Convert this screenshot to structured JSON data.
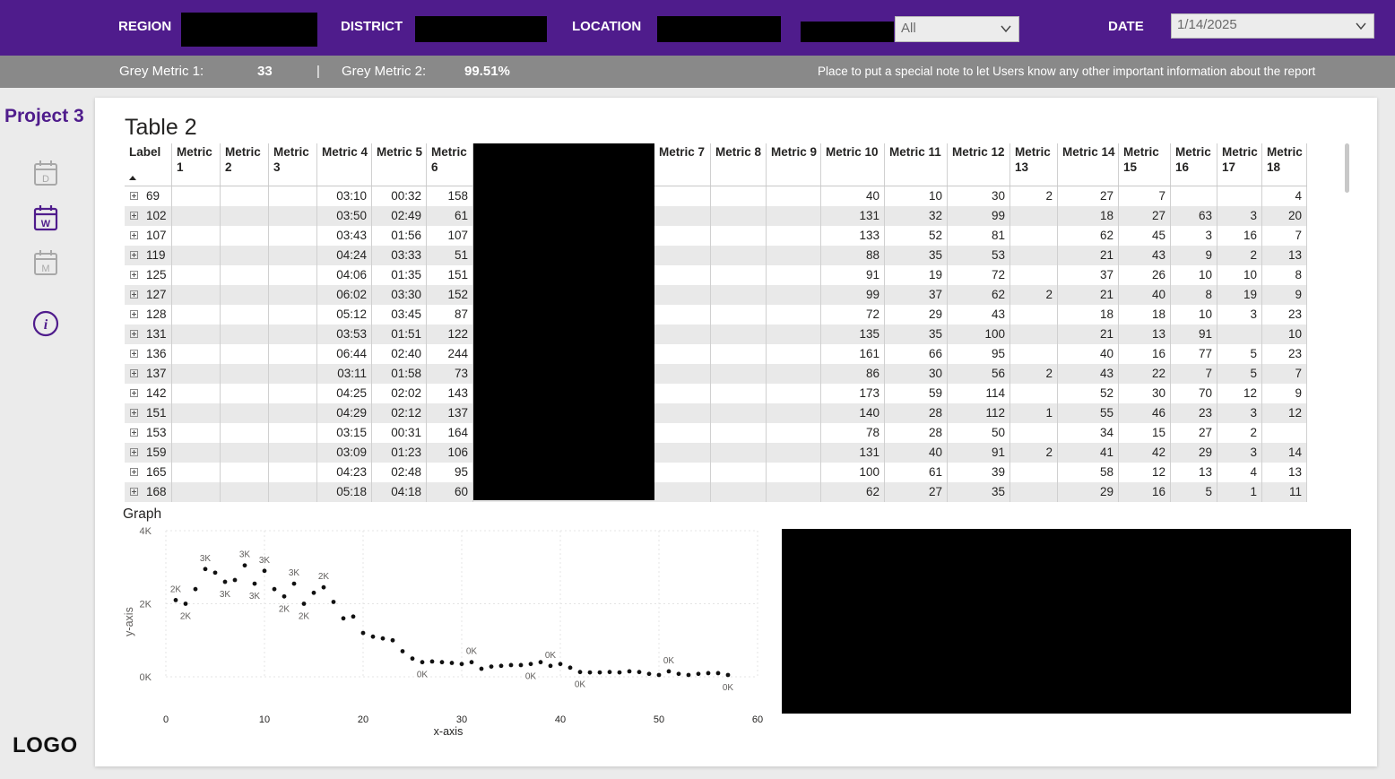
{
  "filters": {
    "region_label": "REGION",
    "district_label": "DISTRICT",
    "location_label": "LOCATION",
    "extra_dropdown_value": "All",
    "date_label": "DATE",
    "date_value": "1/14/2025"
  },
  "metrics_bar": {
    "m1_label": "Grey Metric 1:",
    "m1_value": "33",
    "separator": "|",
    "m2_label": "Grey Metric 2:",
    "m2_value": "99.51%",
    "note": "Place to put a special note to let Users know any other important information about the report"
  },
  "sidebar": {
    "project": "Project 3",
    "icons": [
      "calendar-day-icon",
      "calendar-week-icon",
      "calendar-month-icon",
      "info-icon"
    ],
    "day_letter": "D",
    "week_letter": "W",
    "month_letter": "M",
    "info_letter": "i",
    "logo": "LOGO"
  },
  "colors": {
    "brand_purple": "#4f1c8c",
    "grey_bar": "#898989",
    "row_alt": "#e9e9e9"
  },
  "table": {
    "title": "Table 2",
    "headers": [
      "Label",
      "Metric 1",
      "Metric 2",
      "Metric 3",
      "Metric 4",
      "Metric 5",
      "Metric 6",
      "",
      "Metric 7",
      "Metric 8",
      "Metric 9",
      "Metric 10",
      "Metric 11",
      "Metric 12",
      "Metric 13",
      "Metric 14",
      "Metric 15",
      "Metric 16",
      "Metric 17",
      "Metric 18"
    ],
    "rows": [
      [
        "69",
        "",
        "",
        "",
        "03:10",
        "00:32",
        "158",
        "",
        "",
        "",
        "",
        "40",
        "10",
        "30",
        "2",
        "27",
        "7",
        "",
        "",
        "4"
      ],
      [
        "102",
        "",
        "",
        "",
        "03:50",
        "02:49",
        "61",
        "",
        "",
        "",
        "",
        "131",
        "32",
        "99",
        "",
        "18",
        "27",
        "63",
        "3",
        "20"
      ],
      [
        "107",
        "",
        "",
        "",
        "03:43",
        "01:56",
        "107",
        "",
        "",
        "",
        "",
        "133",
        "52",
        "81",
        "",
        "62",
        "45",
        "3",
        "16",
        "7"
      ],
      [
        "119",
        "",
        "",
        "",
        "04:24",
        "03:33",
        "51",
        "",
        "",
        "",
        "",
        "88",
        "35",
        "53",
        "",
        "21",
        "43",
        "9",
        "2",
        "13"
      ],
      [
        "125",
        "",
        "",
        "",
        "04:06",
        "01:35",
        "151",
        "",
        "",
        "",
        "",
        "91",
        "19",
        "72",
        "",
        "37",
        "26",
        "10",
        "10",
        "8"
      ],
      [
        "127",
        "",
        "",
        "",
        "06:02",
        "03:30",
        "152",
        "",
        "",
        "",
        "",
        "99",
        "37",
        "62",
        "2",
        "21",
        "40",
        "8",
        "19",
        "9"
      ],
      [
        "128",
        "",
        "",
        "",
        "05:12",
        "03:45",
        "87",
        "",
        "",
        "",
        "",
        "72",
        "29",
        "43",
        "",
        "18",
        "18",
        "10",
        "3",
        "23"
      ],
      [
        "131",
        "",
        "",
        "",
        "03:53",
        "01:51",
        "122",
        "",
        "",
        "",
        "",
        "135",
        "35",
        "100",
        "",
        "21",
        "13",
        "91",
        "",
        "10"
      ],
      [
        "136",
        "",
        "",
        "",
        "06:44",
        "02:40",
        "244",
        "",
        "",
        "",
        "",
        "161",
        "66",
        "95",
        "",
        "40",
        "16",
        "77",
        "5",
        "23"
      ],
      [
        "137",
        "",
        "",
        "",
        "03:11",
        "01:58",
        "73",
        "",
        "",
        "",
        "",
        "86",
        "30",
        "56",
        "2",
        "43",
        "22",
        "7",
        "5",
        "7"
      ],
      [
        "142",
        "",
        "",
        "",
        "04:25",
        "02:02",
        "143",
        "",
        "",
        "",
        "",
        "173",
        "59",
        "114",
        "",
        "52",
        "30",
        "70",
        "12",
        "9"
      ],
      [
        "151",
        "",
        "",
        "",
        "04:29",
        "02:12",
        "137",
        "",
        "",
        "",
        "",
        "140",
        "28",
        "112",
        "1",
        "55",
        "46",
        "23",
        "3",
        "12"
      ],
      [
        "153",
        "",
        "",
        "",
        "03:15",
        "00:31",
        "164",
        "",
        "",
        "",
        "",
        "78",
        "28",
        "50",
        "",
        "34",
        "15",
        "27",
        "2",
        ""
      ],
      [
        "159",
        "",
        "",
        "",
        "03:09",
        "01:23",
        "106",
        "",
        "",
        "",
        "",
        "131",
        "40",
        "91",
        "2",
        "41",
        "42",
        "29",
        "3",
        "14"
      ],
      [
        "165",
        "",
        "",
        "",
        "04:23",
        "02:48",
        "95",
        "",
        "",
        "",
        "",
        "100",
        "61",
        "39",
        "",
        "58",
        "12",
        "13",
        "4",
        "13"
      ],
      [
        "168",
        "",
        "",
        "",
        "05:18",
        "04:18",
        "60",
        "",
        "",
        "",
        "",
        "62",
        "27",
        "35",
        "",
        "29",
        "16",
        "5",
        "1",
        "11"
      ]
    ]
  },
  "chart_data": {
    "type": "scatter",
    "title": "Graph",
    "xlabel": "x-axis",
    "ylabel": "y-axis",
    "xlim": [
      0,
      60
    ],
    "ylim": [
      0,
      4000
    ],
    "x_ticks": [
      "0",
      "10",
      "20",
      "30",
      "40",
      "50",
      "60"
    ],
    "y_ticks": [
      "0K",
      "2K",
      "4K"
    ],
    "grid": true,
    "series": [
      {
        "x": [
          1,
          2,
          3,
          4,
          5,
          6,
          7,
          8,
          9,
          10,
          11,
          12,
          13,
          14,
          15,
          16,
          17,
          18,
          19,
          20,
          21,
          22,
          23,
          24,
          25,
          26,
          27,
          28,
          29,
          30,
          31,
          32,
          33,
          34,
          35,
          36,
          37,
          38,
          39,
          40,
          41,
          42,
          43,
          44,
          45,
          46,
          47,
          48,
          49,
          50,
          51,
          52,
          53,
          54,
          55,
          56,
          57
        ],
        "y": [
          2100,
          2000,
          2400,
          2950,
          2850,
          2600,
          2650,
          3050,
          2550,
          2900,
          2400,
          2200,
          2550,
          2000,
          2300,
          2450,
          2050,
          1600,
          1650,
          1200,
          1100,
          1050,
          1000,
          700,
          500,
          400,
          420,
          400,
          380,
          350,
          400,
          220,
          280,
          300,
          320,
          320,
          350,
          400,
          300,
          350,
          250,
          130,
          120,
          120,
          130,
          120,
          150,
          130,
          80,
          50,
          150,
          80,
          50,
          80,
          100,
          100,
          50
        ]
      }
    ],
    "point_labels": [
      {
        "x": 1,
        "text": "2K"
      },
      {
        "x": 2,
        "text": "2K"
      },
      {
        "x": 4,
        "text": "3K"
      },
      {
        "x": 6,
        "text": "3K"
      },
      {
        "x": 8,
        "text": "3K"
      },
      {
        "x": 9,
        "text": "3K"
      },
      {
        "x": 10,
        "text": "3K"
      },
      {
        "x": 12,
        "text": "2K"
      },
      {
        "x": 13,
        "text": "3K"
      },
      {
        "x": 14,
        "text": "2K"
      },
      {
        "x": 16,
        "text": "2K"
      },
      {
        "x": 26,
        "text": "0K"
      },
      {
        "x": 31,
        "text": "0K"
      },
      {
        "x": 37,
        "text": "0K"
      },
      {
        "x": 39,
        "text": "0K"
      },
      {
        "x": 42,
        "text": "0K"
      },
      {
        "x": 51,
        "text": "0K"
      },
      {
        "x": 57,
        "text": "0K"
      }
    ]
  }
}
